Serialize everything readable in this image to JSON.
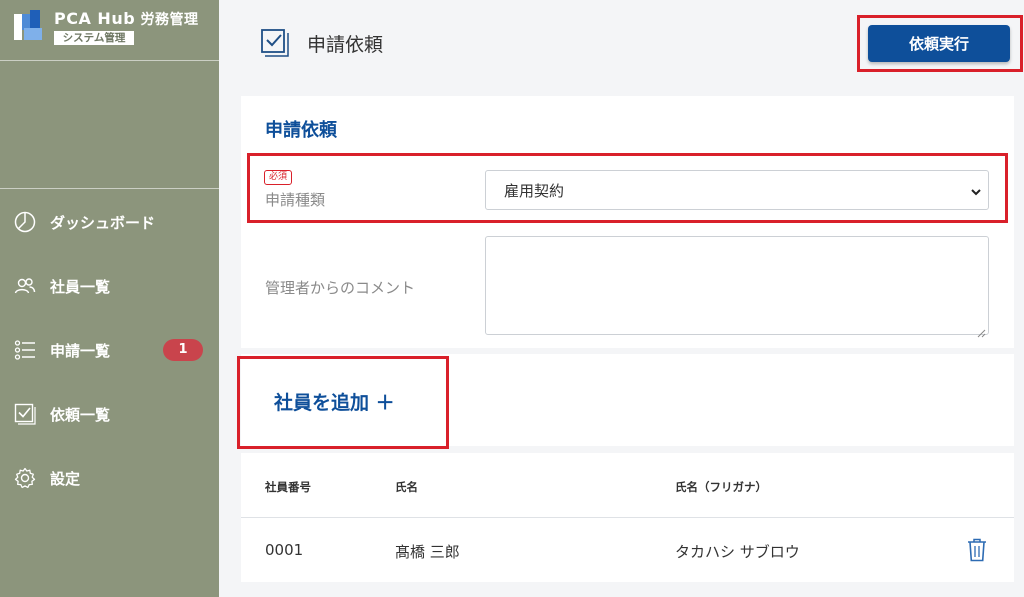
{
  "app": {
    "name": "PCA Hub",
    "product": "労務管理",
    "subtitle": "システム管理"
  },
  "sidebar": {
    "items": [
      {
        "label": "ダッシュボード",
        "icon": "clock-chart-icon"
      },
      {
        "label": "社員一覧",
        "icon": "people-icon"
      },
      {
        "label": "申請一覧",
        "icon": "list-icon",
        "badge": "1"
      },
      {
        "label": "依頼一覧",
        "icon": "checkbox-icon"
      },
      {
        "label": "設定",
        "icon": "gear-icon"
      }
    ]
  },
  "header": {
    "title": "申請依頼",
    "submit_label": "依頼実行"
  },
  "form": {
    "section_title": "申請依頼",
    "required_label": "必須",
    "type_label": "申請種類",
    "type_value": "雇用契約",
    "comment_label": "管理者からのコメント",
    "comment_value": ""
  },
  "employees": {
    "add_label": "社員を追加 ＋",
    "columns": [
      "社員番号",
      "氏名",
      "氏名（フリガナ）"
    ],
    "rows": [
      {
        "id": "0001",
        "name": "髙橋 三郎",
        "kana": "タカハシ サブロウ"
      }
    ]
  },
  "colors": {
    "sidebar": "#8c957c",
    "primary": "#0e4f9a",
    "highlight": "#d9202a",
    "badge": "#c9444c"
  }
}
